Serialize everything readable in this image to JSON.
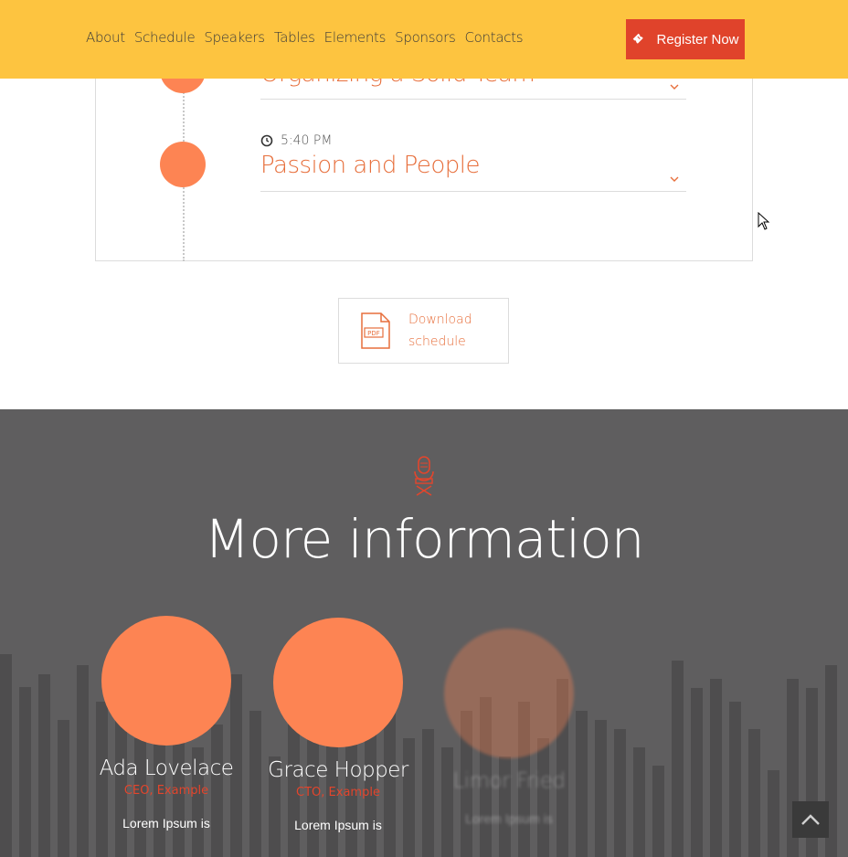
{
  "header": {
    "nav": [
      "About",
      "Schedule",
      "Speakers",
      "Tables",
      "Elements",
      "Sponsors",
      "Contacts"
    ],
    "register_label": "Register Now"
  },
  "schedule": {
    "items": [
      {
        "time": "",
        "title": "Organizing a Solid Team"
      },
      {
        "time": "5:40 PM",
        "title": "Passion and People"
      }
    ]
  },
  "download": {
    "label": "Download schedule",
    "badge": "PDF"
  },
  "more": {
    "title": "More information",
    "speakers": [
      {
        "name": "Ada Lovelace",
        "role": "CEO, Example",
        "desc": "Lorem Ipsum is"
      },
      {
        "name": "Grace Hopper",
        "role": "CTO, Example",
        "desc": "Lorem Ipsum is"
      },
      {
        "name": "Limor Fried",
        "role": "",
        "desc": "Lorem Ipsum is"
      }
    ]
  },
  "colors": {
    "header_bg": "#fdc440",
    "accent": "#e0432b",
    "dot": "#fd8453",
    "dark_bg": "#5f5e5f"
  }
}
